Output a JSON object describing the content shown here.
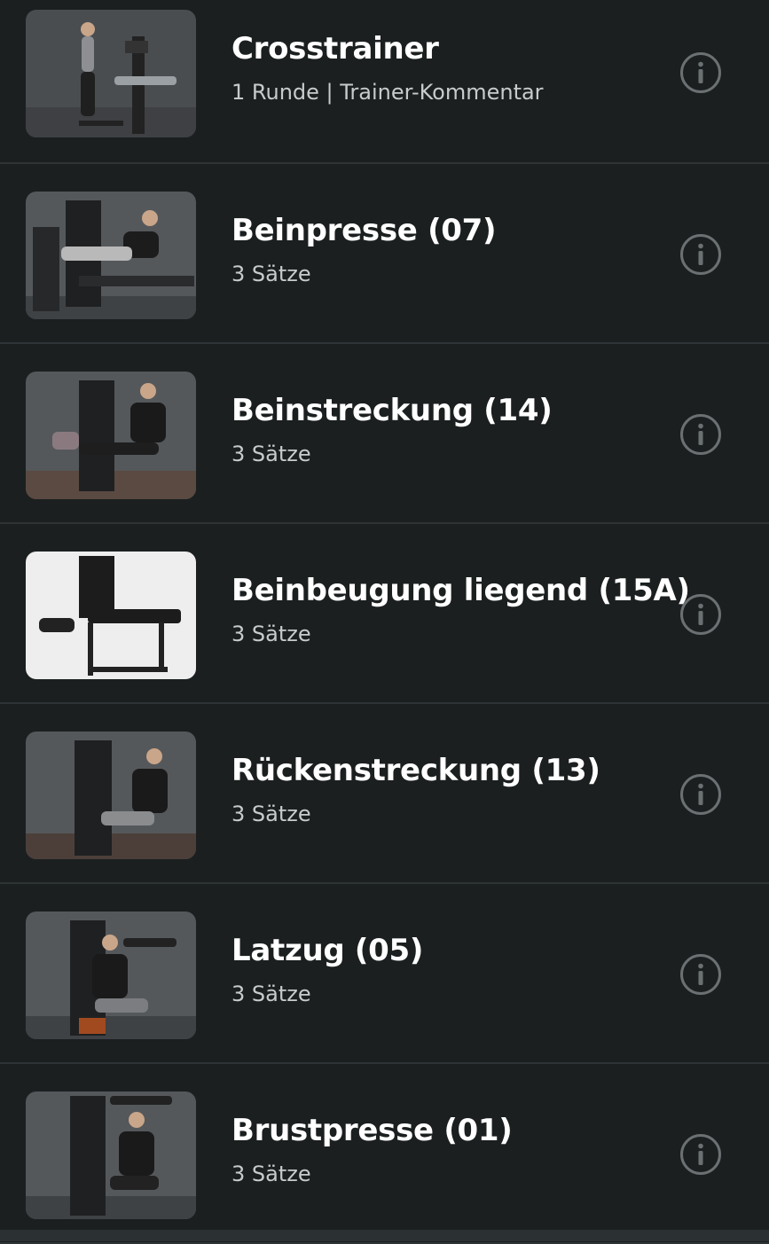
{
  "exercises": [
    {
      "title": "Crosstrainer",
      "subtitle": "1 Runde | Trainer-Kommentar",
      "image": "crosstrainer-photo",
      "thumb_bg": "#4a4d50",
      "icon": "info-icon"
    },
    {
      "title": "Beinpresse (07)",
      "subtitle": "3 Sätze",
      "image": "leg-press-photo",
      "thumb_bg": "#55585b",
      "icon": "info-icon"
    },
    {
      "title": "Beinstreckung (14)",
      "subtitle": "3 Sätze",
      "image": "leg-extension-photo",
      "thumb_bg": "#55585b",
      "icon": "info-icon"
    },
    {
      "title": "Beinbeugung liegend (15A)",
      "subtitle": "3 Sätze",
      "image": "prone-leg-curl-photo",
      "thumb_bg": "#eeeeee",
      "icon": "info-icon"
    },
    {
      "title": "Rückenstreckung (13)",
      "subtitle": "3 Sätze",
      "image": "back-extension-photo",
      "thumb_bg": "#55585b",
      "icon": "info-icon"
    },
    {
      "title": "Latzug (05)",
      "subtitle": "3 Sätze",
      "image": "lat-pulldown-photo",
      "thumb_bg": "#55585b",
      "icon": "info-icon"
    },
    {
      "title": "Brustpresse (01)",
      "subtitle": "3 Sätze",
      "image": "chest-press-photo",
      "thumb_bg": "#55585b",
      "icon": "info-icon"
    }
  ],
  "colors": {
    "background": "#1b1f20",
    "divider": "#2e3436",
    "subtitle": "#c8cbcc",
    "info_icon": "#6b7072"
  }
}
